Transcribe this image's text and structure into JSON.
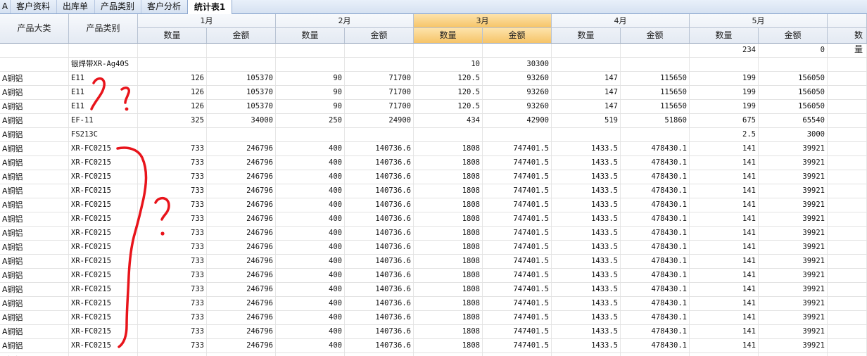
{
  "tabs": [
    {
      "label": "A",
      "active": false
    },
    {
      "label": "客户资料",
      "active": false
    },
    {
      "label": "出库单",
      "active": false
    },
    {
      "label": "产品类别",
      "active": false
    },
    {
      "label": "客户分析",
      "active": false
    },
    {
      "label": "统计表1",
      "active": true
    }
  ],
  "header": {
    "col_big_category": "产品大类",
    "col_category": "产品类别",
    "months": [
      "1月",
      "2月",
      "3月",
      "4月",
      "5月"
    ],
    "selected_month": "3月",
    "qty_label": "数量",
    "amount_label": "金额"
  },
  "rows": [
    {
      "big": "",
      "cat": "",
      "v": [
        "",
        "",
        "",
        "",
        "",
        "",
        "",
        "",
        "234",
        "0"
      ]
    },
    {
      "big": "",
      "cat": "银焊带XR-Ag40S",
      "v": [
        "",
        "",
        "",
        "",
        "10",
        "30300",
        "",
        "",
        "",
        ""
      ]
    },
    {
      "big": "A铜铝",
      "cat": "E11",
      "v": [
        "126",
        "105370",
        "90",
        "71700",
        "120.5",
        "93260",
        "147",
        "115650",
        "199",
        "156050"
      ]
    },
    {
      "big": "A铜铝",
      "cat": "E11",
      "v": [
        "126",
        "105370",
        "90",
        "71700",
        "120.5",
        "93260",
        "147",
        "115650",
        "199",
        "156050"
      ]
    },
    {
      "big": "A铜铝",
      "cat": "E11",
      "v": [
        "126",
        "105370",
        "90",
        "71700",
        "120.5",
        "93260",
        "147",
        "115650",
        "199",
        "156050"
      ]
    },
    {
      "big": "A铜铝",
      "cat": "EF-11",
      "v": [
        "325",
        "34000",
        "250",
        "24900",
        "434",
        "42900",
        "519",
        "51860",
        "675",
        "65540"
      ]
    },
    {
      "big": "A铜铝",
      "cat": "FS213C",
      "v": [
        "",
        "",
        "",
        "",
        "",
        "",
        "",
        "",
        "2.5",
        "3000"
      ]
    },
    {
      "big": "A铜铝",
      "cat": "XR-FC0215",
      "v": [
        "733",
        "246796",
        "400",
        "140736.6",
        "1808",
        "747401.5",
        "1433.5",
        "478430.1",
        "141",
        "39921"
      ]
    },
    {
      "big": "A铜铝",
      "cat": "XR-FC0215",
      "v": [
        "733",
        "246796",
        "400",
        "140736.6",
        "1808",
        "747401.5",
        "1433.5",
        "478430.1",
        "141",
        "39921"
      ]
    },
    {
      "big": "A铜铝",
      "cat": "XR-FC0215",
      "v": [
        "733",
        "246796",
        "400",
        "140736.6",
        "1808",
        "747401.5",
        "1433.5",
        "478430.1",
        "141",
        "39921"
      ]
    },
    {
      "big": "A铜铝",
      "cat": "XR-FC0215",
      "v": [
        "733",
        "246796",
        "400",
        "140736.6",
        "1808",
        "747401.5",
        "1433.5",
        "478430.1",
        "141",
        "39921"
      ]
    },
    {
      "big": "A铜铝",
      "cat": "XR-FC0215",
      "v": [
        "733",
        "246796",
        "400",
        "140736.6",
        "1808",
        "747401.5",
        "1433.5",
        "478430.1",
        "141",
        "39921"
      ]
    },
    {
      "big": "A铜铝",
      "cat": "XR-FC0215",
      "v": [
        "733",
        "246796",
        "400",
        "140736.6",
        "1808",
        "747401.5",
        "1433.5",
        "478430.1",
        "141",
        "39921"
      ]
    },
    {
      "big": "A铜铝",
      "cat": "XR-FC0215",
      "v": [
        "733",
        "246796",
        "400",
        "140736.6",
        "1808",
        "747401.5",
        "1433.5",
        "478430.1",
        "141",
        "39921"
      ]
    },
    {
      "big": "A铜铝",
      "cat": "XR-FC0215",
      "v": [
        "733",
        "246796",
        "400",
        "140736.6",
        "1808",
        "747401.5",
        "1433.5",
        "478430.1",
        "141",
        "39921"
      ]
    },
    {
      "big": "A铜铝",
      "cat": "XR-FC0215",
      "v": [
        "733",
        "246796",
        "400",
        "140736.6",
        "1808",
        "747401.5",
        "1433.5",
        "478430.1",
        "141",
        "39921"
      ]
    },
    {
      "big": "A铜铝",
      "cat": "XR-FC0215",
      "v": [
        "733",
        "246796",
        "400",
        "140736.6",
        "1808",
        "747401.5",
        "1433.5",
        "478430.1",
        "141",
        "39921"
      ]
    },
    {
      "big": "A铜铝",
      "cat": "XR-FC0215",
      "v": [
        "733",
        "246796",
        "400",
        "140736.6",
        "1808",
        "747401.5",
        "1433.5",
        "478430.1",
        "141",
        "39921"
      ]
    },
    {
      "big": "A铜铝",
      "cat": "XR-FC0215",
      "v": [
        "733",
        "246796",
        "400",
        "140736.6",
        "1808",
        "747401.5",
        "1433.5",
        "478430.1",
        "141",
        "39921"
      ]
    },
    {
      "big": "A铜铝",
      "cat": "XR-FC0215",
      "v": [
        "733",
        "246796",
        "400",
        "140736.6",
        "1808",
        "747401.5",
        "1433.5",
        "478430.1",
        "141",
        "39921"
      ]
    },
    {
      "big": "A铜铝",
      "cat": "XR-FC0215",
      "v": [
        "733",
        "246796",
        "400",
        "140736.6",
        "1808",
        "747401.5",
        "1433.5",
        "478430.1",
        "141",
        "39921"
      ]
    },
    {
      "big": "A铜铝",
      "cat": "XR-FC0215",
      "v": [
        "733",
        "246796",
        "400",
        "140736.6",
        "1808",
        "747401.5",
        "1433.5",
        "478430.1",
        "141",
        "39921"
      ]
    },
    {
      "big": "A铜铝",
      "cat": "",
      "v": [
        "",
        "",
        "",
        "",
        "",
        "",
        "",
        "",
        "",
        ""
      ]
    }
  ],
  "annotations": {
    "question_mark_1": "?",
    "question_mark_2": "?",
    "ink_color": "#e8141b"
  },
  "colors": {
    "selected_header": "#f6c468",
    "header_bg": "#e4eaf3",
    "tab_bar": "#d5e1f1"
  }
}
